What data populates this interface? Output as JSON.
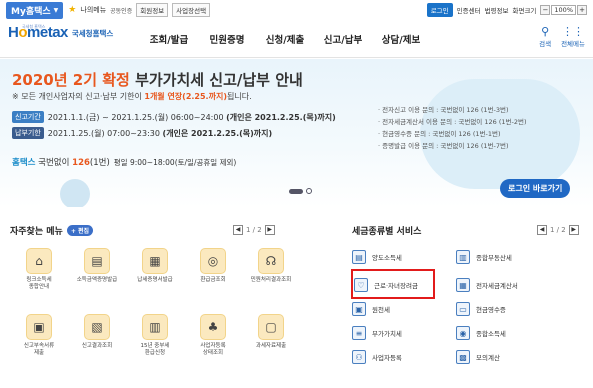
{
  "topbar": {
    "myhome": "My홈택스",
    "my_menu": "나의메뉴",
    "links": [
      "공동인증",
      "회원정보",
      "사업장선택"
    ],
    "login": "로그인",
    "right_links": [
      "인증센터",
      "법령정보",
      "화면크기"
    ],
    "zoom": "100%"
  },
  "header": {
    "logo_main_1": "H",
    "logo_main_o": "o",
    "logo_main_2": "metax",
    "logo_sub": "국세청홈택스",
    "logo_tiny": "국세청 홈택스",
    "nav": [
      "조회/발급",
      "민원증명",
      "신청/제출",
      "신고/납부",
      "상담/제보"
    ],
    "search": "검색",
    "all_menu": "전체메뉴"
  },
  "banner": {
    "title_hl": "2020년 2기 확정",
    "title_rest": " 부가가치세 신고/납부 안내",
    "sub_pre": "※ 모든 개인사업자의 신고·납부 기한이 ",
    "sub_bold": "1개월 연장(2.25.까지)",
    "sub_post": "됩니다.",
    "row1_tag": "신고기간",
    "row1_text": "2021.1.1.(금) ~ 2021.1.25.(월) 06:00~24:00 ",
    "row1_em": "(개인은 2021.2.25.(목)까지)",
    "row2_tag": "납부기한",
    "row2_text": "2021.1.25.(월) 07:00~23:30 ",
    "row2_em": "(개인은 2021.2.25.(목)까지)",
    "phone_brand": "홈택스",
    "phone_pre": " 국번없이 ",
    "phone_num": "126",
    "phone_post": "(1번)",
    "phone_hours": "평일 9:00~18:00(토/일/공휴일 제외)",
    "info": [
      "· 전자신고 이용 문의 : 국번없이 126 (1번-3번)",
      "· 전자세금계산서 이용 문의 : 국번없이 126 (1번-2번)",
      "· 현금영수증 문의 : 국번없이 126 (1번-1번)",
      "· 증명발급 이용 문의 : 국번없이 126 (1번-7번)"
    ],
    "login_button": "로그인 바로가기"
  },
  "favorites": {
    "title": "자주찾는 메뉴",
    "edit": "+ 편집",
    "page": "1 / 2",
    "items": [
      {
        "icon": "home-icon",
        "glyph": "⌂",
        "label": "링크소득세\n종합안내"
      },
      {
        "icon": "certificate-icon",
        "glyph": "▤",
        "label": "소득금액증명발급"
      },
      {
        "icon": "document-icon",
        "glyph": "▦",
        "label": "납세증명서발급"
      },
      {
        "icon": "refund-icon",
        "glyph": "◎",
        "label": "환급금조회"
      },
      {
        "icon": "headset-icon",
        "glyph": "☊",
        "label": "민원처리결과조회"
      },
      {
        "icon": "form-icon",
        "glyph": "▣",
        "label": "신고부속서류\n제출"
      },
      {
        "icon": "search-doc-icon",
        "glyph": "▧",
        "label": "신고결과조회"
      },
      {
        "icon": "calendar-icon",
        "glyph": "▥",
        "label": "15년 중부세\n환급신청"
      },
      {
        "icon": "people-icon",
        "glyph": "♣",
        "label": "사업자등록\n상태조회"
      },
      {
        "icon": "monitor-icon",
        "glyph": "▢",
        "label": "과세자료제출"
      }
    ]
  },
  "tax_services": {
    "title": "세금종류별 서비스",
    "page": "1 / 2",
    "items": [
      {
        "icon": "income-tax-icon",
        "glyph": "▤",
        "label": "양도소득세"
      },
      {
        "icon": "comprehensive-tax-icon",
        "glyph": "▥",
        "label": "종합부동산세"
      },
      {
        "icon": "heart-icon",
        "glyph": "♡",
        "label": "근로·자녀장려금"
      },
      {
        "icon": "e-invoice-icon",
        "glyph": "▦",
        "label": "전자세금계산서"
      },
      {
        "icon": "withholding-icon",
        "glyph": "▣",
        "label": "원천세"
      },
      {
        "icon": "cash-receipt-icon",
        "glyph": "▭",
        "label": "현금영수증"
      },
      {
        "icon": "vat-icon",
        "glyph": "≡",
        "label": "부가가치세"
      },
      {
        "icon": "global-income-icon",
        "glyph": "◉",
        "label": "종합소득세"
      },
      {
        "icon": "business-reg-icon",
        "glyph": "⚇",
        "label": "사업자등록"
      },
      {
        "icon": "calculator-icon",
        "glyph": "▩",
        "label": "모의계산"
      }
    ]
  }
}
